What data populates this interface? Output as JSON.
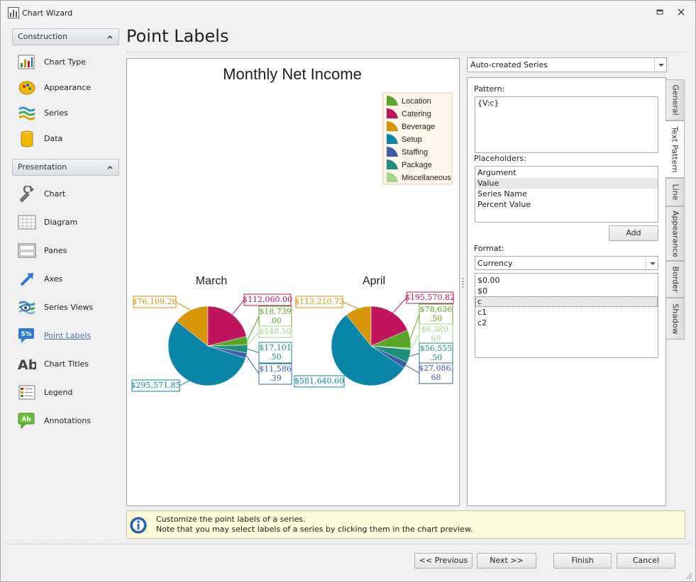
{
  "window": {
    "title": "Chart Wizard"
  },
  "nav": {
    "construction": {
      "header": "Construction",
      "items": [
        {
          "label": "Chart Type",
          "icon": "chart-type-icon"
        },
        {
          "label": "Appearance",
          "icon": "appearance-icon"
        },
        {
          "label": "Series",
          "icon": "series-icon"
        },
        {
          "label": "Data",
          "icon": "data-icon"
        }
      ]
    },
    "presentation": {
      "header": "Presentation",
      "items": [
        {
          "label": "Chart",
          "icon": "wrench-icon"
        },
        {
          "label": "Diagram",
          "icon": "diagram-icon"
        },
        {
          "label": "Panes",
          "icon": "panes-icon"
        },
        {
          "label": "Axes",
          "icon": "axes-icon"
        },
        {
          "label": "Series Views",
          "icon": "series-views-icon"
        },
        {
          "label": "Point Labels",
          "icon": "point-labels-icon",
          "badge": "5%"
        },
        {
          "label": "Chart Titles",
          "icon": "chart-titles-icon",
          "badge": "Ab"
        },
        {
          "label": "Legend",
          "icon": "legend-icon"
        },
        {
          "label": "Annotations",
          "icon": "annotations-icon",
          "badge": "Ab"
        }
      ]
    }
  },
  "page": {
    "title": "Point Labels"
  },
  "chart_data": {
    "type": "pie",
    "title": "Monthly Net Income",
    "legend": {
      "placement": "top-right",
      "entries": [
        {
          "name": "Location",
          "color": "#5ba628"
        },
        {
          "name": "Catering",
          "color": "#c0145e"
        },
        {
          "name": "Beverage",
          "color": "#d79508"
        },
        {
          "name": "Setup",
          "color": "#0a86a8"
        },
        {
          "name": "Staffing",
          "color": "#3f5ca8"
        },
        {
          "name": "Package",
          "color": "#1e8f7a"
        },
        {
          "name": "Miscellaneous",
          "color": "#a3d68a"
        }
      ]
    },
    "series": [
      {
        "name": "March",
        "values": [
          76109.26,
          112060.0,
          18739.0,
          148.5,
          17101.5,
          11586.39,
          295571.85
        ],
        "categories": [
          "Beverage",
          "Catering",
          "Location",
          "Miscellaneous",
          "Package",
          "Staffing",
          "Setup"
        ],
        "labels": [
          "$76,109.26",
          "$112,060.00",
          "$18,739\n.00",
          "$148.50",
          "$17,101\n.50",
          "$11,586\n.39",
          "$295,571.85"
        ]
      },
      {
        "name": "April",
        "values": [
          113210.73,
          195570.82,
          78636.5,
          6380.69,
          56555.5,
          27086.68,
          581640.6
        ],
        "categories": [
          "Beverage",
          "Catering",
          "Location",
          "Miscellaneous",
          "Package",
          "Staffing",
          "Setup"
        ],
        "labels": [
          "$113,210.73",
          "$195,570.82",
          "$78,636\n.50",
          "$6,380.\n69",
          "$56,555\n.50",
          "$27,086.\n68",
          "$581,640.60"
        ]
      }
    ]
  },
  "series_select": {
    "value": "Auto-created Series"
  },
  "tabs": [
    {
      "label": "General"
    },
    {
      "label": "Text Pattern"
    },
    {
      "label": "Line"
    },
    {
      "label": "Appearance"
    },
    {
      "label": "Border"
    },
    {
      "label": "Shadow"
    }
  ],
  "text_pattern": {
    "pattern_label": "Pattern:",
    "pattern_value": "{V:c}",
    "placeholders_label": "Placeholders:",
    "placeholders": [
      "Argument",
      "Value",
      "Series Name",
      "Percent Value"
    ],
    "add_label": "Add",
    "format_label": "Format:",
    "format_value": "Currency",
    "format_items": [
      "$0.00",
      "$0",
      "c",
      "c1",
      "c2"
    ]
  },
  "info": {
    "line1": "Customize the point labels of a series.",
    "line2": "Note that you may select labels of a series by clicking them in the chart preview."
  },
  "footer": {
    "previous": "<< Previous",
    "next": "Next >>",
    "finish": "Finish",
    "cancel": "Cancel"
  }
}
